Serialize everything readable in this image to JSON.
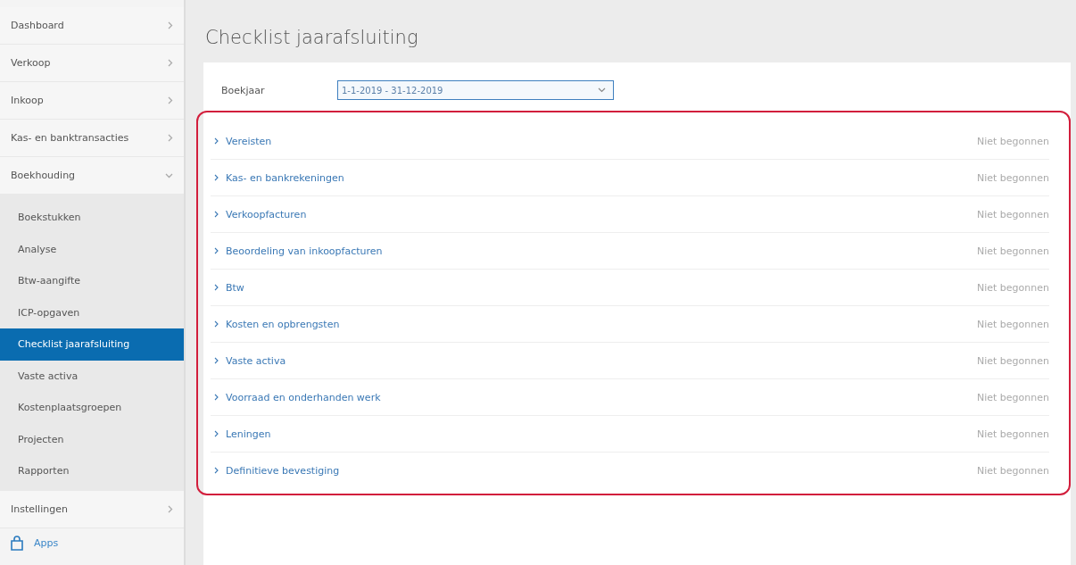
{
  "sidebar": {
    "items": [
      {
        "label": "Dashboard",
        "kind": "menu",
        "expanded": false
      },
      {
        "label": "Verkoop",
        "kind": "menu",
        "expanded": false
      },
      {
        "label": "Inkoop",
        "kind": "menu",
        "expanded": false
      },
      {
        "label": "Kas- en banktransacties",
        "kind": "menu",
        "expanded": false
      },
      {
        "label": "Boekhouding",
        "kind": "menu",
        "expanded": true,
        "children": [
          {
            "label": "Boekstukken",
            "selected": false
          },
          {
            "label": "Analyse",
            "selected": false
          },
          {
            "label": "Btw-aangifte",
            "selected": false
          },
          {
            "label": "ICP-opgaven",
            "selected": false
          },
          {
            "label": "Checklist jaarafsluiting",
            "selected": true
          },
          {
            "label": "Vaste activa",
            "selected": false
          },
          {
            "label": "Kostenplaatsgroepen",
            "selected": false
          },
          {
            "label": "Projecten",
            "selected": false
          },
          {
            "label": "Rapporten",
            "selected": false
          }
        ]
      },
      {
        "label": "Instellingen",
        "kind": "menu",
        "expanded": false
      },
      {
        "label": "Apps",
        "kind": "app"
      }
    ]
  },
  "page": {
    "title": "Checklist jaarafsluiting",
    "fiscal_year": {
      "label": "Boekjaar",
      "value": "1-1-2019 - 31-12-2019"
    },
    "checklist": {
      "highlighted": true,
      "sections": [
        {
          "label": "Vereisten",
          "status": "Niet begonnen"
        },
        {
          "label": "Kas- en bankrekeningen",
          "status": "Niet begonnen"
        },
        {
          "label": "Verkoopfacturen",
          "status": "Niet begonnen"
        },
        {
          "label": "Beoordeling van inkoopfacturen",
          "status": "Niet begonnen"
        },
        {
          "label": "Btw",
          "status": "Niet begonnen"
        },
        {
          "label": "Kosten en opbrengsten",
          "status": "Niet begonnen"
        },
        {
          "label": "Vaste activa",
          "status": "Niet begonnen"
        },
        {
          "label": "Voorraad en onderhanden werk",
          "status": "Niet begonnen"
        },
        {
          "label": "Leningen",
          "status": "Niet begonnen"
        },
        {
          "label": "Definitieve bevestiging",
          "status": "Niet begonnen"
        }
      ]
    }
  }
}
